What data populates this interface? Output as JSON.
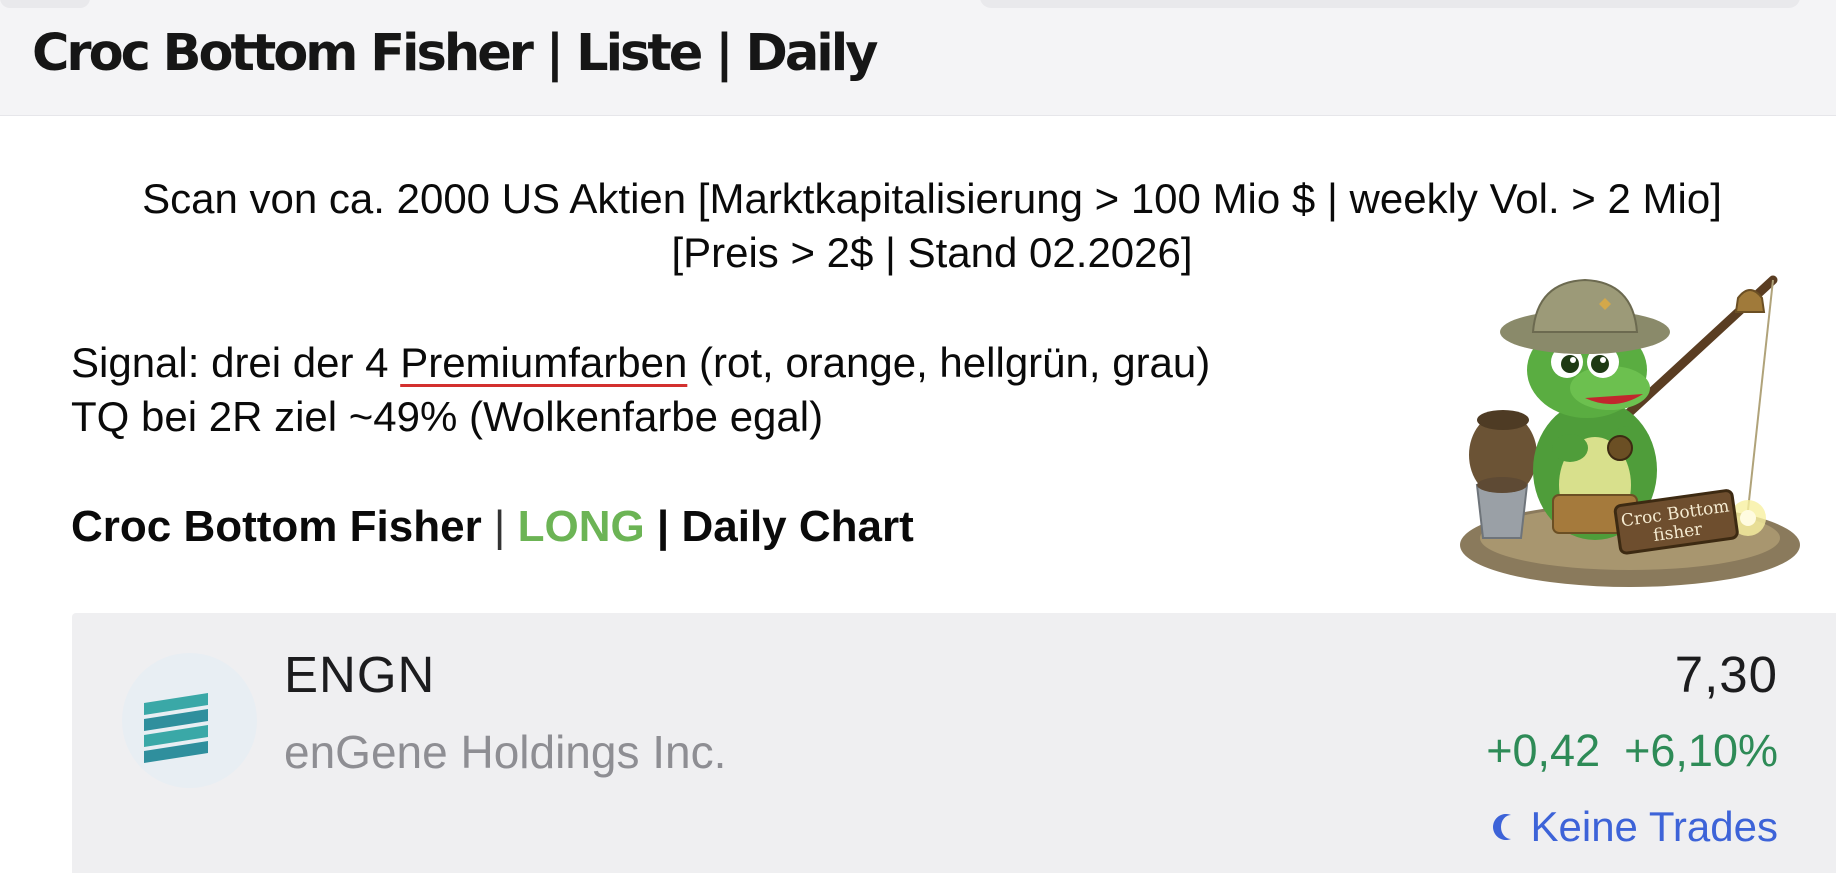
{
  "header": {
    "title": "Croc Bottom Fisher | Liste | Daily"
  },
  "scan": {
    "line1": "Scan von ca. 2000 US Aktien [Marktkapitalisierung > 100 Mio $ | weekly Vol. > 2 Mio]",
    "line2": "[Preis > 2$ | Stand 02.2026]"
  },
  "signal": {
    "prefix": "Signal: drei der 4 ",
    "highlight": "Premiumfarben",
    "suffix": " (rot, orange, hellgrün, grau)",
    "tq_line": "TQ bei 2R ziel ~49% (Wolkenfarbe egal)"
  },
  "strategy": {
    "name": "Croc Bottom Fisher",
    "separator": " | ",
    "direction": "LONG",
    "separator2": " | ",
    "chart": "Daily Chart"
  },
  "mascot": {
    "caption_line1": "Croc Bottom",
    "caption_line2": "fisher"
  },
  "stock": {
    "ticker": "ENGN",
    "company": "enGene Holdings Inc.",
    "price": "7,30",
    "change_abs": "+0,42",
    "change_pct": "+6,10%",
    "trades": "Keine Trades",
    "logo_icon": "engene-stacked-bars-icon",
    "trades_icon": "moon-icon"
  },
  "colors": {
    "long": "#6cb455",
    "positive": "#2e8b57",
    "link": "#3d63d8",
    "underline": "#d3302f"
  }
}
